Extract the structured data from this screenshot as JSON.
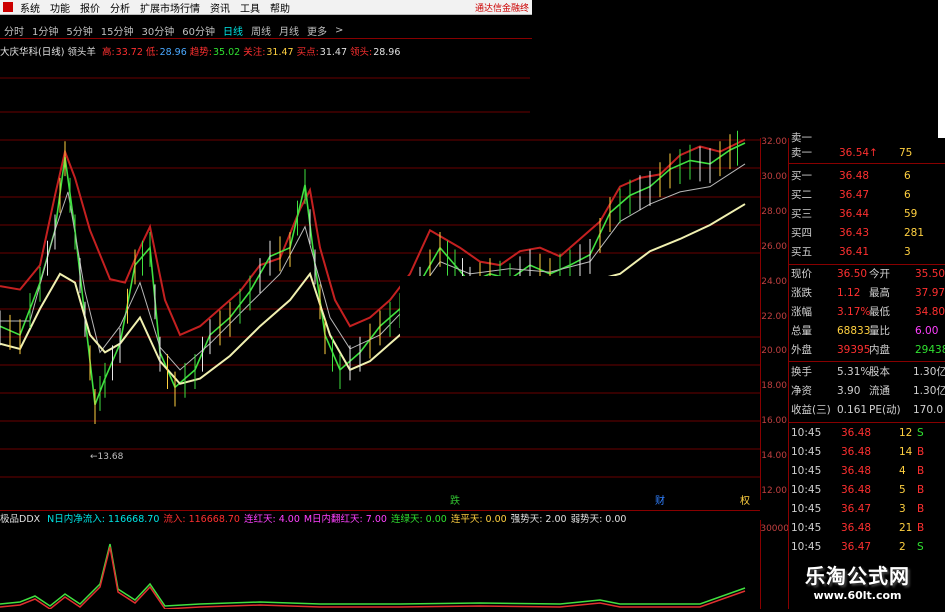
{
  "menu": {
    "items": [
      "系统",
      "功能",
      "报价",
      "分析",
      "扩展市场行情",
      "资讯",
      "工具",
      "帮助"
    ],
    "brand": "通达信金融终"
  },
  "periods": {
    "items": [
      "分时",
      "1分钟",
      "5分钟",
      "15分钟",
      "30分钟",
      "60分钟",
      "日线",
      "周线",
      "月线",
      "更多"
    ],
    "active_index": 6,
    "more_arrow": ">"
  },
  "chart_info": {
    "title": "大庆华科(日线) 领头羊",
    "fields": [
      {
        "label": "高:",
        "value": "33.72",
        "color": "#ff3030"
      },
      {
        "label": "低:",
        "value": "28.96",
        "color": "#4aa8ff"
      },
      {
        "label": "趋势:",
        "value": "35.02",
        "color": "#30e030"
      },
      {
        "label": "关注:",
        "value": "31.47",
        "color": "#ffd040"
      },
      {
        "label": "买点:",
        "value": "31.47",
        "color": "#e0e0e0"
      },
      {
        "label": "领头:",
        "value": "28.96",
        "color": "#e0e0e0"
      }
    ]
  },
  "price_axis": [
    "32.00",
    "30.00",
    "28.00",
    "26.00",
    "24.00",
    "22.00",
    "20.00",
    "18.00",
    "16.00",
    "14.00",
    "12.00"
  ],
  "low_marker": "←13.68",
  "event_markers": [
    "跌",
    "财",
    "权"
  ],
  "indicator": {
    "name": "极品DDX",
    "fields": [
      {
        "text": "N日内净流入: 116668.70",
        "color": "#00e5e5"
      },
      {
        "text": "流入: 116668.70",
        "color": "#ff3030"
      },
      {
        "text": "连红天: 4.00",
        "color": "#ff40ff"
      },
      {
        "text": "M日内翻红天: 7.00",
        "color": "#ff40ff"
      },
      {
        "text": "连绿天: 0.00",
        "color": "#30e030"
      },
      {
        "text": "连平天: 0.00",
        "color": "#ffd040"
      },
      {
        "text": "强势天: 2.00",
        "color": "#e0e0e0"
      },
      {
        "text": "弱势天: 0.00",
        "color": "#e0e0e0"
      }
    ],
    "axis_label": "30000"
  },
  "quote_panel": {
    "top_partial": "卖一",
    "sell": [
      {
        "label": "卖一",
        "price": "36.54",
        "arrow": "↑",
        "vol": "75"
      }
    ],
    "buy": [
      {
        "label": "买一",
        "price": "36.48",
        "vol": "6"
      },
      {
        "label": "买二",
        "price": "36.47",
        "vol": "6"
      },
      {
        "label": "买三",
        "price": "36.44",
        "vol": "59"
      },
      {
        "label": "买四",
        "price": "36.43",
        "vol": "281"
      },
      {
        "label": "买五",
        "price": "36.41",
        "vol": "3"
      }
    ],
    "stats": [
      {
        "l1": "现价",
        "v1": "36.50",
        "c1": "#ff3030",
        "l2": "今开",
        "v2": "35.50",
        "c2": "#ff3030"
      },
      {
        "l1": "涨跌",
        "v1": "1.12",
        "c1": "#ff3030",
        "l2": "最高",
        "v2": "37.97",
        "c2": "#ff3030"
      },
      {
        "l1": "涨幅",
        "v1": "3.17%",
        "c1": "#ff3030",
        "l2": "最低",
        "v2": "34.80",
        "c2": "#ff3030"
      },
      {
        "l1": "总量",
        "v1": "68833",
        "c1": "#ffd040",
        "l2": "量比",
        "v2": "6.00",
        "c2": "#ff40ff"
      },
      {
        "l1": "外盘",
        "v1": "39395",
        "c1": "#ff3030",
        "l2": "内盘",
        "v2": "29438",
        "c2": "#30e030"
      }
    ],
    "stats2": [
      {
        "l1": "换手",
        "v1": "5.31%",
        "l2": "股本",
        "v2": "1.30亿"
      },
      {
        "l1": "净资",
        "v1": "3.90",
        "l2": "流通",
        "v2": "1.30亿"
      },
      {
        "l1": "收益(三)",
        "v1": "0.161",
        "l2": "PE(动)",
        "v2": "170.0"
      }
    ],
    "ticks": [
      {
        "time": "10:45",
        "price": "36.48",
        "vol": "12",
        "side": "S"
      },
      {
        "time": "10:45",
        "price": "36.48",
        "vol": "14",
        "side": "B"
      },
      {
        "time": "10:45",
        "price": "36.48",
        "vol": "4",
        "side": "B"
      },
      {
        "time": "10:45",
        "price": "36.48",
        "vol": "5",
        "side": "B"
      },
      {
        "time": "10:45",
        "price": "36.47",
        "vol": "3",
        "side": "B"
      },
      {
        "time": "10:45",
        "price": "36.48",
        "vol": "21",
        "side": "B"
      },
      {
        "time": "10:45",
        "price": "36.47",
        "vol": "2",
        "side": "S"
      }
    ]
  },
  "watermark": {
    "title": "乐淘公式网",
    "url": "www.60lt.com"
  },
  "colors": {
    "up": "#ff3030",
    "down": "#30e030",
    "grid": "#6a0000",
    "active": "#00e5e5"
  }
}
